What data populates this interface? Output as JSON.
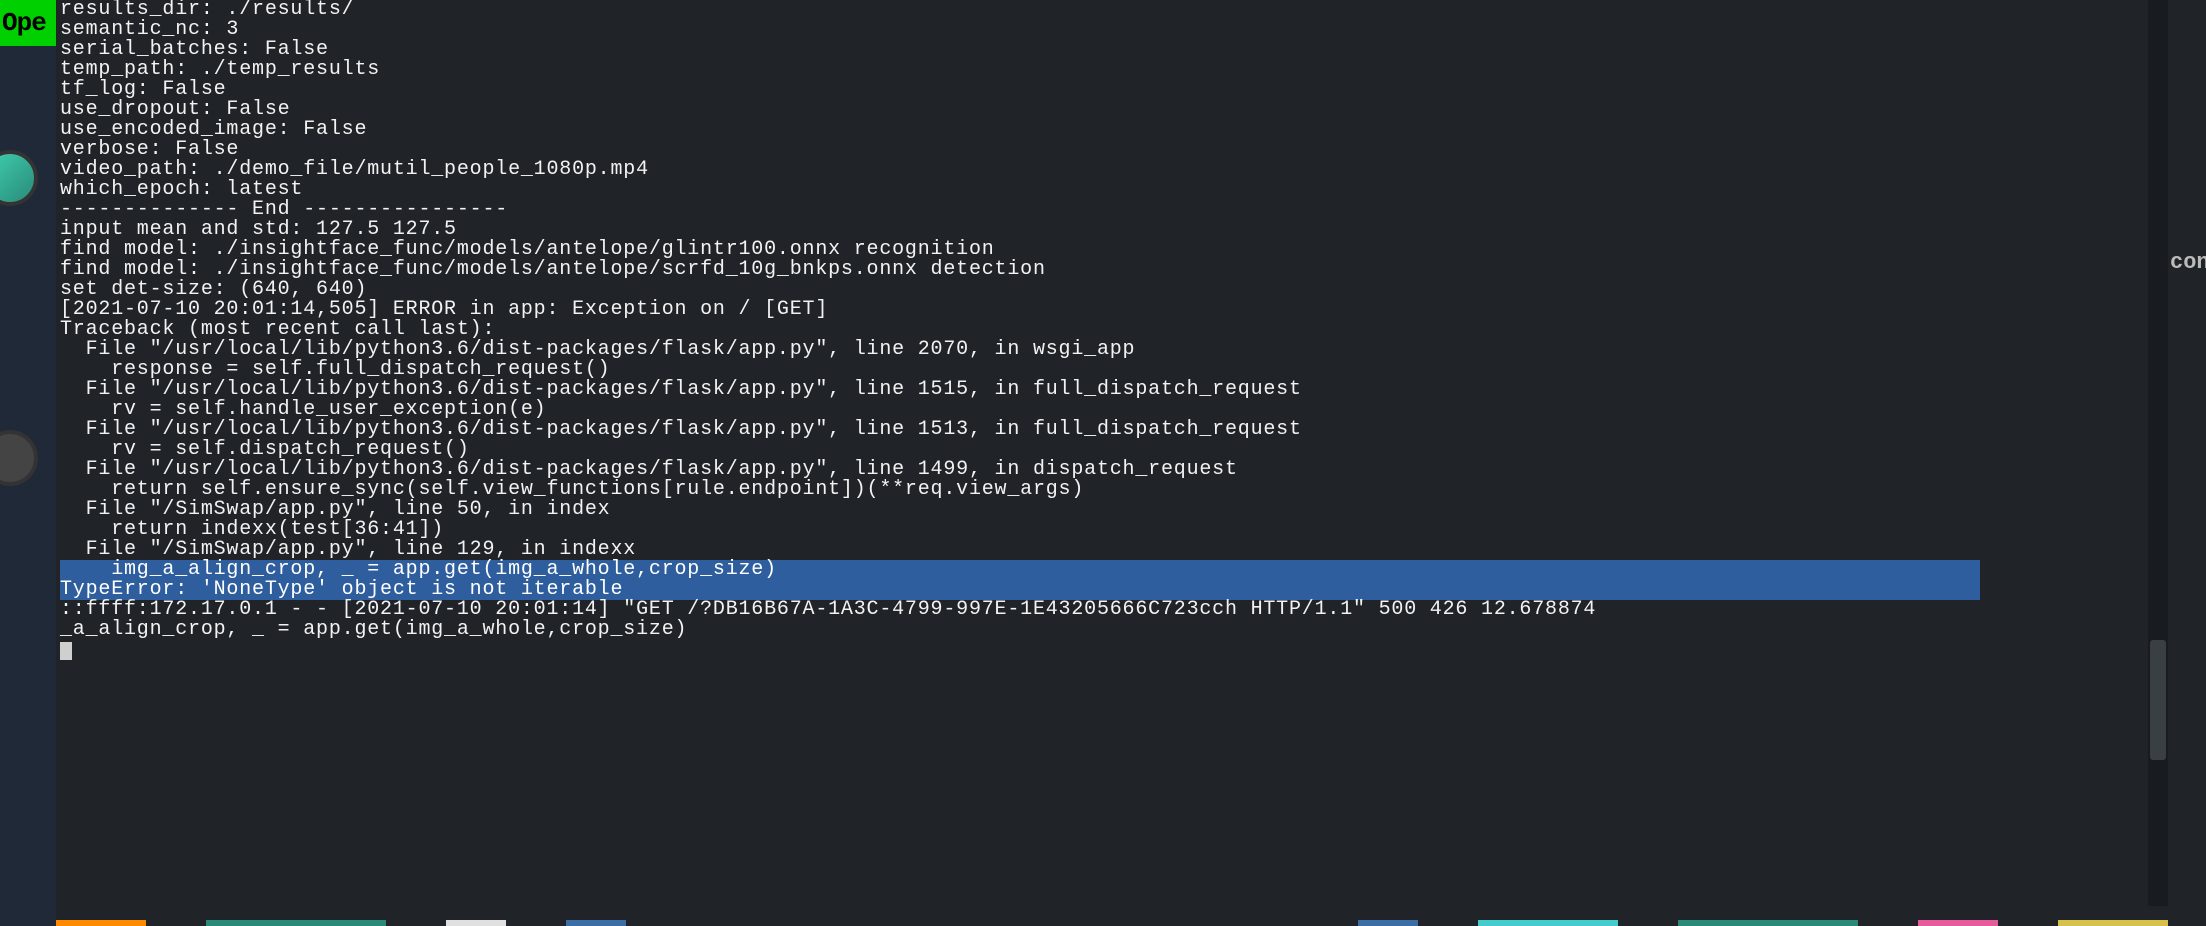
{
  "left_badge": "Ope",
  "right_cut_text": "con",
  "terminal": {
    "lines": [
      "results_dir: ./results/",
      "semantic_nc: 3",
      "serial_batches: False",
      "temp_path: ./temp_results",
      "tf_log: False",
      "use_dropout: False",
      "use_encoded_image: False",
      "verbose: False",
      "video_path: ./demo_file/mutil_people_1080p.mp4",
      "which_epoch: latest",
      "-------------- End ----------------",
      "input mean and std: 127.5 127.5",
      "find model: ./insightface_func/models/antelope/glintr100.onnx recognition",
      "find model: ./insightface_func/models/antelope/scrfd_10g_bnkps.onnx detection",
      "set det-size: (640, 640)",
      "[2021-07-10 20:01:14,505] ERROR in app: Exception on / [GET]",
      "Traceback (most recent call last):",
      "  File \"/usr/local/lib/python3.6/dist-packages/flask/app.py\", line 2070, in wsgi_app",
      "    response = self.full_dispatch_request()",
      "  File \"/usr/local/lib/python3.6/dist-packages/flask/app.py\", line 1515, in full_dispatch_request",
      "    rv = self.handle_user_exception(e)",
      "  File \"/usr/local/lib/python3.6/dist-packages/flask/app.py\", line 1513, in full_dispatch_request",
      "    rv = self.dispatch_request()",
      "  File \"/usr/local/lib/python3.6/dist-packages/flask/app.py\", line 1499, in dispatch_request",
      "    return self.ensure_sync(self.view_functions[rule.endpoint])(**req.view_args)",
      "  File \"/SimSwap/app.py\", line 50, in index",
      "    return indexx(test[36:41])",
      "  File \"/SimSwap/app.py\", line 129, in indexx"
    ],
    "selected_lines": [
      "    img_a_align_crop, _ = app.get(img_a_whole,crop_size)",
      "TypeError: 'NoneType' object is not iterable"
    ],
    "after_lines": [
      "::ffff:172.17.0.1 - - [2021-07-10 20:01:14] \"GET /?DB16B67A-1A3C-4799-997E-1E43205666C723cch HTTP/1.1\" 500 426 12.678874",
      "_a_align_crop, _ = app.get(img_a_whole,crop_size)"
    ]
  }
}
